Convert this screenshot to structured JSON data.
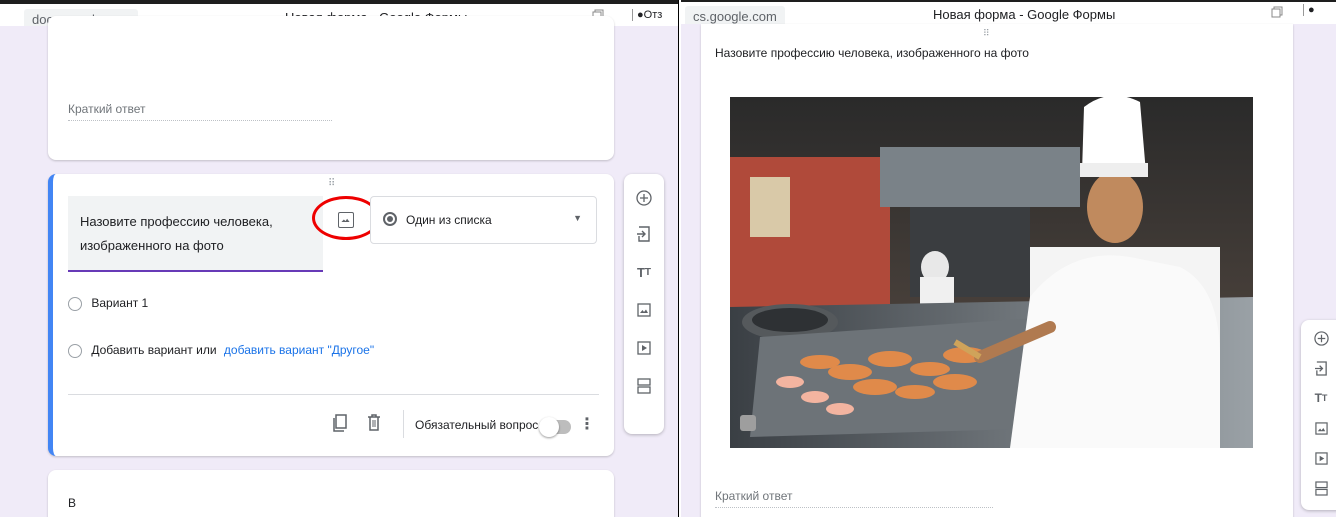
{
  "left": {
    "url": "docs.google.com",
    "title": "Новая форма - Google Формы",
    "feedback": "Отз",
    "short_answer": "Краткий ответ",
    "question": "Назовите профессию человека, изображенного на фото",
    "question_type": "Один из списка",
    "option1": "Вариант 1",
    "add_option": "Добавить вариант",
    "or": "или",
    "add_other": "добавить вариант \"Другое\"",
    "required": "Обязательный вопрос",
    "bottom_letter": "В"
  },
  "right": {
    "url": "cs.google.com",
    "title": "Новая форма - Google Формы",
    "question": "Назовите профессию человека, изображенного на фото",
    "short_answer": "Краткий ответ"
  },
  "colors": {
    "accent": "#673ab7",
    "left_stripe": "#4285f4",
    "annotation": "#e00000",
    "link": "#1a73e8",
    "canvas": "#f0ebf8"
  },
  "icons": [
    "add-question-icon",
    "import-icon",
    "title-icon",
    "image-icon",
    "video-icon",
    "section-icon",
    "copy-icon",
    "delete-icon",
    "more-icon",
    "drag-handle-icon",
    "dropdown-arrow-icon"
  ]
}
